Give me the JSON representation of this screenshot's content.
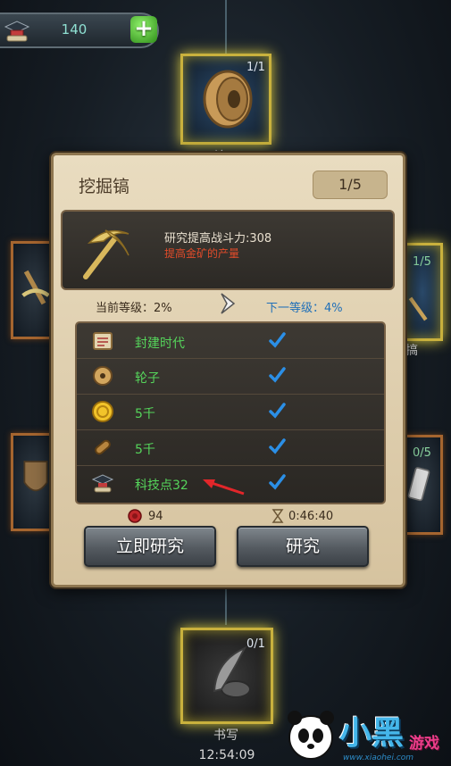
{
  "resource_bar": {
    "value": "140",
    "plus_label": "+"
  },
  "top_node": {
    "count": "1/1",
    "label": "轮子"
  },
  "left_nodes": [
    {
      "count": ""
    },
    {
      "count": ""
    }
  ],
  "right_nodes": [
    {
      "count": "1/5",
      "label": "搞"
    },
    {
      "count": "0/5"
    }
  ],
  "dialog": {
    "title": "挖掘镐",
    "page": "1/5",
    "description_line1": "研究提高战斗力:308",
    "description_line2": "提高金矿的产量",
    "current_level": "当前等级：2%",
    "next_level": "下一等级：4%",
    "requirements": [
      {
        "icon": "scroll-icon",
        "label": "封建时代"
      },
      {
        "icon": "wheel-icon",
        "label": "轮子"
      },
      {
        "icon": "gold-coin-icon",
        "label": "5千"
      },
      {
        "icon": "wood-log-icon",
        "label": "5千"
      },
      {
        "icon": "tech-point-icon",
        "label": "科技点32"
      }
    ],
    "cost_wax": "94",
    "research_time": "0:46:40",
    "instant_button": "立即研究",
    "research_button": "研究"
  },
  "bottom_node": {
    "count": "0/1",
    "label": "书写",
    "timer": "12:54:09"
  },
  "watermark": {
    "text_main": "小黑",
    "text_sub": "游戏",
    "url": "www.xiaohei.com"
  },
  "colors": {
    "node_glow": "#d8c83f",
    "requirement_met": "#55d45b",
    "description_red": "#e14b2a",
    "next_level_blue": "#1f6fb8",
    "check_blue": "#2b8fe6"
  }
}
